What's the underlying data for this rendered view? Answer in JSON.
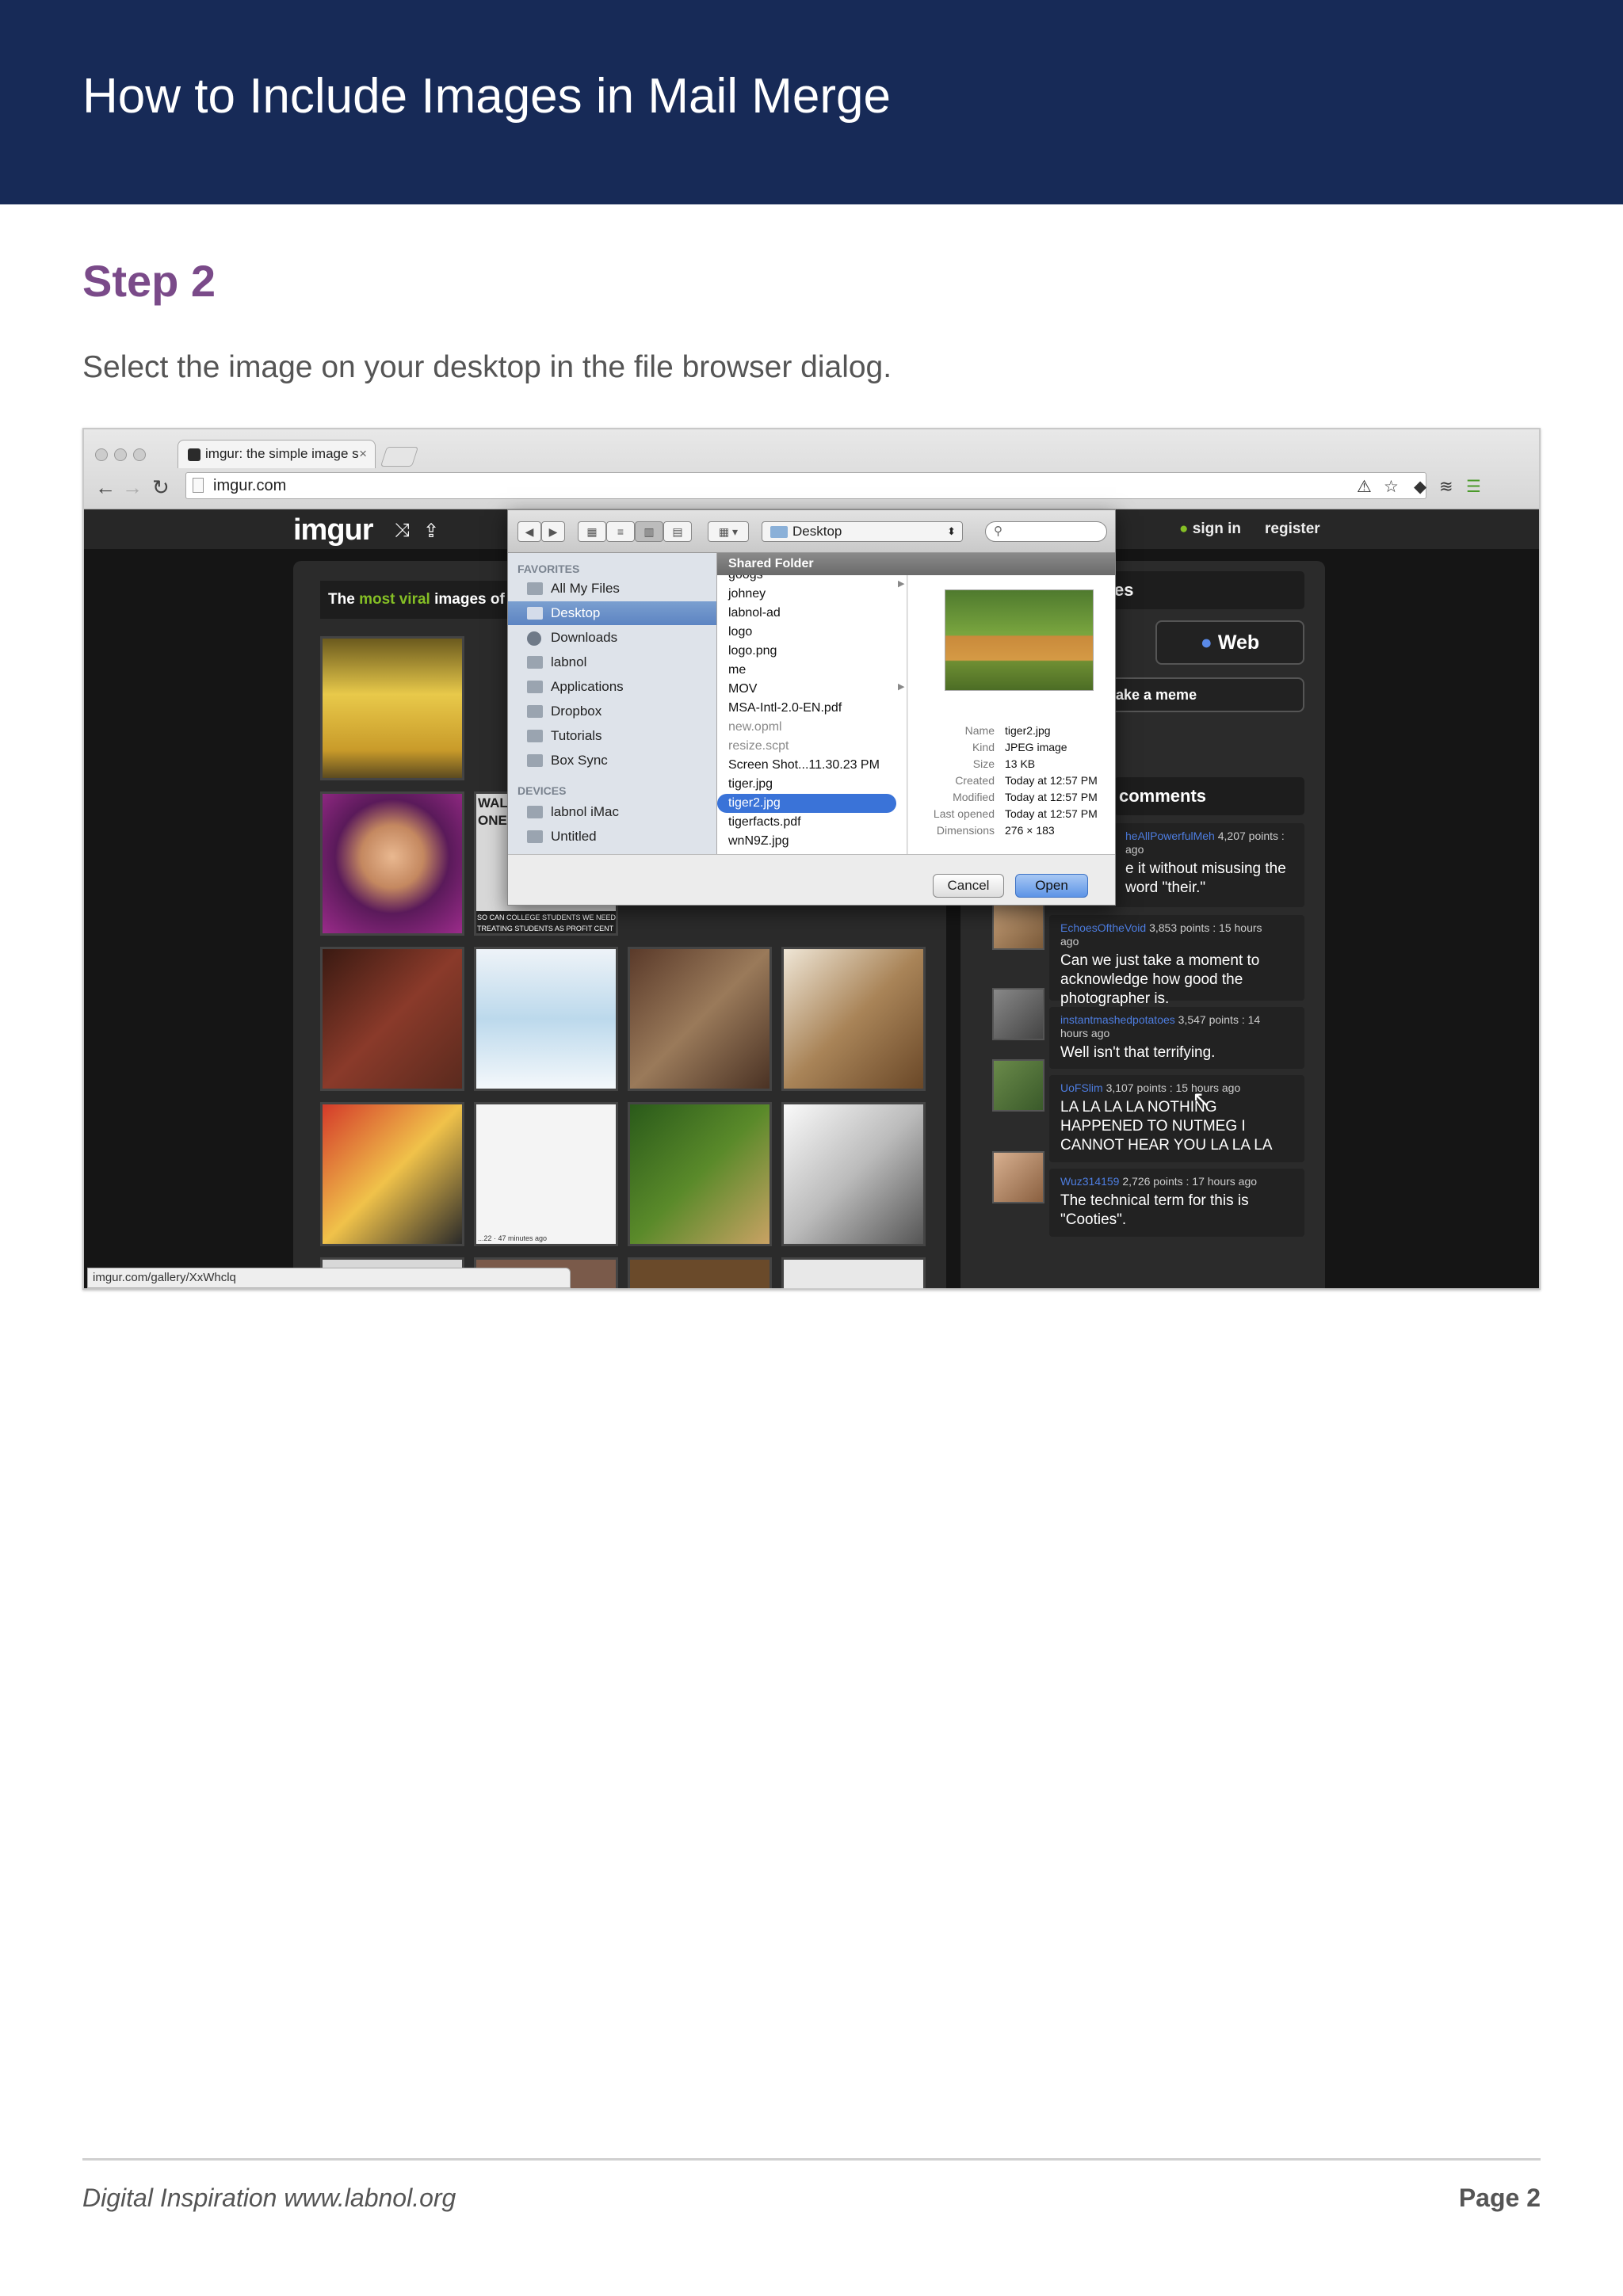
{
  "header": {
    "title": "How to Include Images in Mail Merge",
    "bg_color": "#172a57"
  },
  "step": {
    "title": "Step 2",
    "color": "#7a4a89",
    "description": "Select the image on your desktop in the file browser dialog."
  },
  "screenshot": {
    "browser": {
      "tab_title": "imgur: the simple image s",
      "url": "imgur.com",
      "status_url": "imgur.com/gallery/XxWhclq"
    },
    "imgur": {
      "logo": "imgur",
      "sign_in": "sign in",
      "register": "register",
      "gallery_heading": {
        "pre": "The ",
        "highlight": "most viral",
        "post": " images of"
      },
      "side_heading": "es",
      "web_button": "Web",
      "meme_button": "ake a meme",
      "comments_heading": "comments",
      "comments": [
        {
          "user": "heAllPowerfulMeh",
          "meta": "4,207 points :",
          "meta2": "ago",
          "text": "e it without misusing the",
          "text2": "word \"their.\""
        },
        {
          "user": "EchoesOftheVoid",
          "meta": "3,853 points : 15 hours",
          "meta2": "ago",
          "text": "Can we just take a moment to acknowledge how good the photographer is."
        },
        {
          "user": "instantmashedpotatoes",
          "meta": "3,547 points : 14",
          "meta2": "hours ago",
          "text": "Well isn't that terrifying."
        },
        {
          "user": "UoFSlim",
          "meta": "3,107 points : 15 hours ago",
          "meta2": "",
          "text": "LA LA LA LA NOTHING HAPPENED TO NUTMEG I CANNOT HEAR YOU LA LA LA"
        },
        {
          "user": "Wuz314159",
          "meta": "2,726 points : 17 hours ago",
          "meta2": "",
          "text": "The technical term for this is \"Cooties\"."
        }
      ],
      "thumb_caption_1": "WALL",
      "thumb_caption_2": "ONEY",
      "thumb_caption_3": "SO CAN COLLEGE STUDENTS WE NEED TO",
      "thumb_caption_4": "TREATING STUDENTS AS PROFIT CENT",
      "thumb_caption_5": "...22 · 47 minutes ago"
    },
    "dialog": {
      "location": "Desktop",
      "favorites_label": "FAVORITES",
      "favorites": [
        "All My Files",
        "Desktop",
        "Downloads",
        "labnol",
        "Applications",
        "Dropbox",
        "Tutorials",
        "Box Sync"
      ],
      "devices_label": "DEVICES",
      "devices": [
        "labnol iMac",
        "Untitled"
      ],
      "column_header": "Shared Folder",
      "files": [
        {
          "name": "googs",
          "state": "normal"
        },
        {
          "name": "johney",
          "state": "normal"
        },
        {
          "name": "labnol-ad",
          "state": "normal"
        },
        {
          "name": "logo",
          "state": "normal"
        },
        {
          "name": "logo.png",
          "state": "normal"
        },
        {
          "name": "me",
          "state": "normal"
        },
        {
          "name": "MOV",
          "state": "normal"
        },
        {
          "name": "MSA-Intl-2.0-EN.pdf",
          "state": "normal"
        },
        {
          "name": "new.opml",
          "state": "grey"
        },
        {
          "name": "resize.scpt",
          "state": "grey"
        },
        {
          "name": "Screen Shot...11.30.23 PM",
          "state": "normal"
        },
        {
          "name": "tiger.jpg",
          "state": "normal"
        },
        {
          "name": "tiger2.jpg",
          "state": "selected"
        },
        {
          "name": "tigerfacts.pdf",
          "state": "normal"
        },
        {
          "name": "wnN9Z.jpg",
          "state": "normal"
        }
      ],
      "preview": [
        {
          "label": "Name",
          "value": "tiger2.jpg"
        },
        {
          "label": "Kind",
          "value": "JPEG image"
        },
        {
          "label": "Size",
          "value": "13 KB"
        },
        {
          "label": "Created",
          "value": "Today at 12:57 PM"
        },
        {
          "label": "Modified",
          "value": "Today at 12:57 PM"
        },
        {
          "label": "Last opened",
          "value": "Today at 12:57 PM"
        },
        {
          "label": "Dimensions",
          "value": "276 × 183"
        }
      ],
      "cancel_label": "Cancel",
      "open_label": "Open"
    }
  },
  "footer": {
    "left": "Digital Inspiration www.labnol.org",
    "right": "Page 2"
  }
}
